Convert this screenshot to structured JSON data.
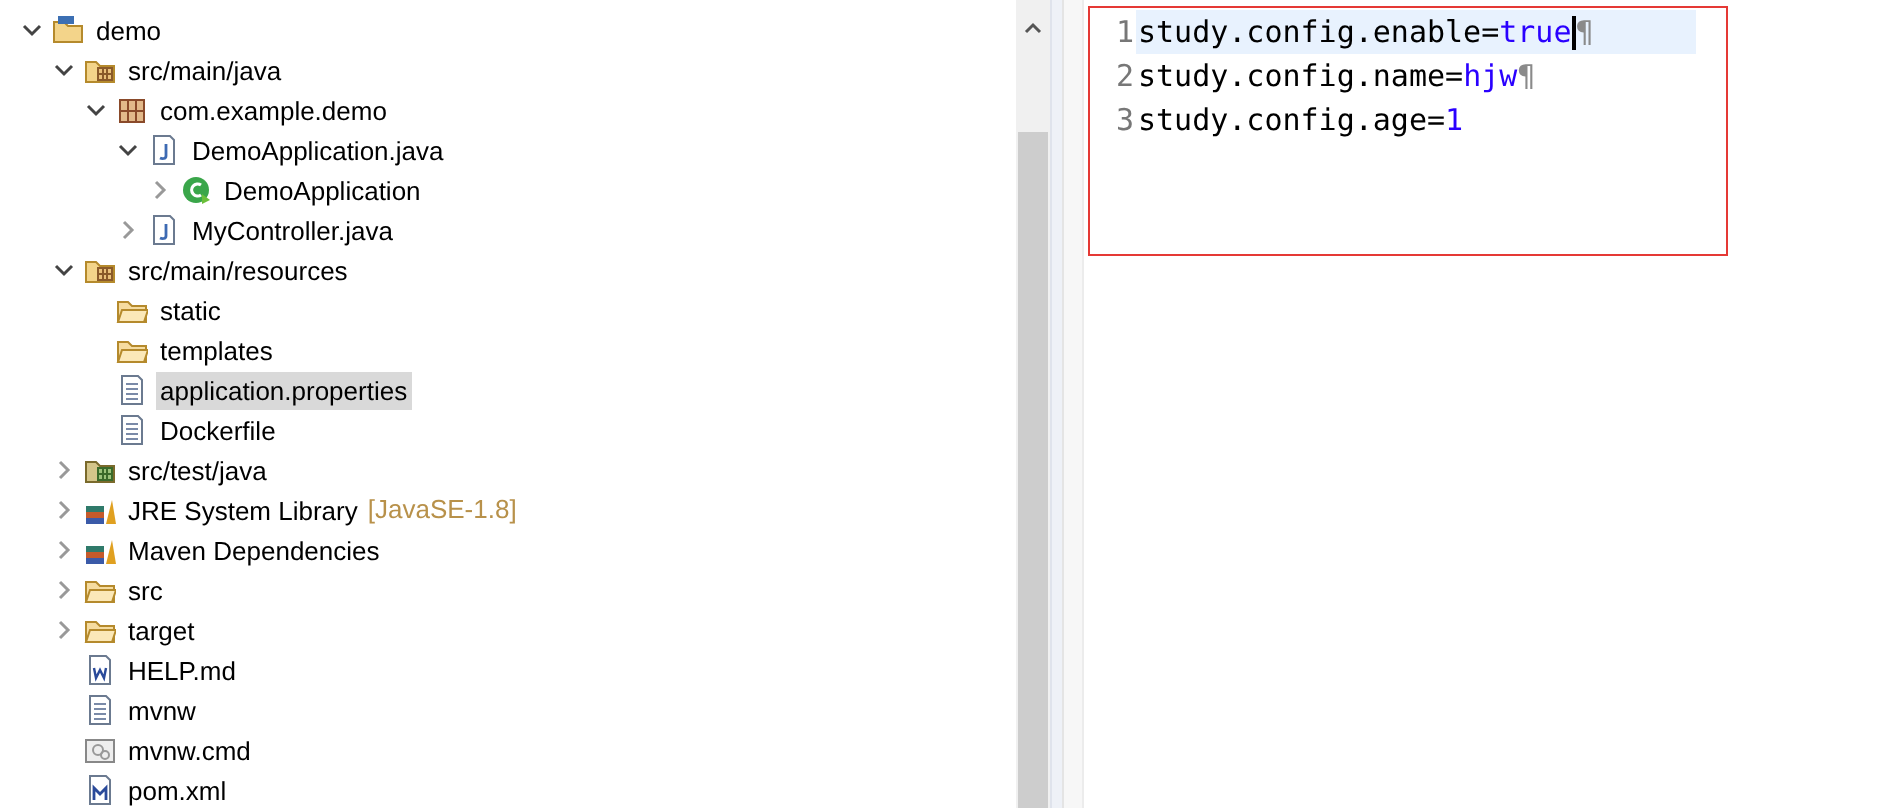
{
  "tree": [
    {
      "label": "demo",
      "kind": "project",
      "expanded": true,
      "selected": false,
      "children": [
        {
          "label": "src/main/java",
          "kind": "source-folder",
          "expanded": true,
          "selected": false,
          "children": [
            {
              "label": "com.example.demo",
              "kind": "package",
              "expanded": true,
              "selected": false,
              "children": [
                {
                  "label": "DemoApplication.java",
                  "kind": "java-file",
                  "expanded": true,
                  "selected": false,
                  "children": [
                    {
                      "label": "DemoApplication",
                      "kind": "class",
                      "expanded": false,
                      "selected": false
                    }
                  ]
                },
                {
                  "label": "MyController.java",
                  "kind": "java-file",
                  "expanded": false,
                  "selected": false
                }
              ]
            }
          ]
        },
        {
          "label": "src/main/resources",
          "kind": "source-folder",
          "expanded": true,
          "selected": false,
          "children": [
            {
              "label": "static",
              "kind": "folder",
              "selected": false
            },
            {
              "label": "templates",
              "kind": "folder",
              "selected": false
            },
            {
              "label": "application.properties",
              "kind": "text-file",
              "selected": true
            },
            {
              "label": "Dockerfile",
              "kind": "text-file",
              "selected": false
            }
          ]
        },
        {
          "label": "src/test/java",
          "kind": "test-folder",
          "expanded": false,
          "selected": false
        },
        {
          "label": "JRE System Library",
          "decoration": "[JavaSE-1.8]",
          "kind": "library",
          "expanded": false,
          "selected": false
        },
        {
          "label": "Maven Dependencies",
          "kind": "library",
          "expanded": false,
          "selected": false
        },
        {
          "label": "src",
          "kind": "folder",
          "expanded": false,
          "selected": false
        },
        {
          "label": "target",
          "kind": "folder",
          "expanded": false,
          "selected": false
        },
        {
          "label": "HELP.md",
          "kind": "word-file",
          "selected": false
        },
        {
          "label": "mvnw",
          "kind": "text-file",
          "selected": false
        },
        {
          "label": "mvnw.cmd",
          "kind": "cmd-file",
          "selected": false
        },
        {
          "label": "pom.xml",
          "kind": "maven-file",
          "selected": false
        }
      ]
    }
  ],
  "editor": {
    "lines": [
      {
        "number": "1",
        "key": "study.config.enable=",
        "value": "true",
        "end_mark": "¶",
        "current": true
      },
      {
        "number": "2",
        "key": "study.config.name=",
        "value": "hjw",
        "end_mark": "¶",
        "current": false
      },
      {
        "number": "3",
        "key": "study.config.age=",
        "value": "1",
        "current": false
      }
    ]
  }
}
